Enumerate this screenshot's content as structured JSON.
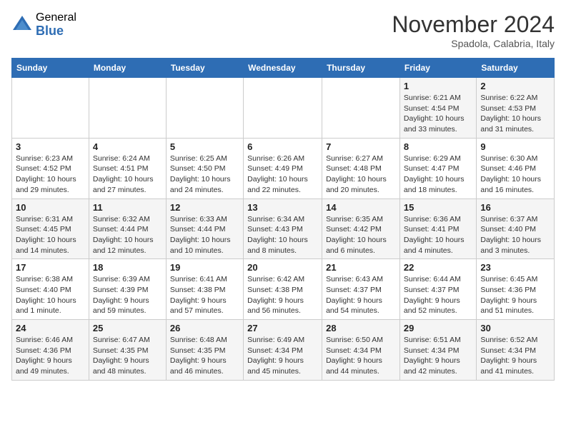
{
  "logo": {
    "general": "General",
    "blue": "Blue"
  },
  "title": "November 2024",
  "location": "Spadola, Calabria, Italy",
  "headers": [
    "Sunday",
    "Monday",
    "Tuesday",
    "Wednesday",
    "Thursday",
    "Friday",
    "Saturday"
  ],
  "weeks": [
    [
      {
        "day": "",
        "info": ""
      },
      {
        "day": "",
        "info": ""
      },
      {
        "day": "",
        "info": ""
      },
      {
        "day": "",
        "info": ""
      },
      {
        "day": "",
        "info": ""
      },
      {
        "day": "1",
        "info": "Sunrise: 6:21 AM\nSunset: 4:54 PM\nDaylight: 10 hours and 33 minutes."
      },
      {
        "day": "2",
        "info": "Sunrise: 6:22 AM\nSunset: 4:53 PM\nDaylight: 10 hours and 31 minutes."
      }
    ],
    [
      {
        "day": "3",
        "info": "Sunrise: 6:23 AM\nSunset: 4:52 PM\nDaylight: 10 hours and 29 minutes."
      },
      {
        "day": "4",
        "info": "Sunrise: 6:24 AM\nSunset: 4:51 PM\nDaylight: 10 hours and 27 minutes."
      },
      {
        "day": "5",
        "info": "Sunrise: 6:25 AM\nSunset: 4:50 PM\nDaylight: 10 hours and 24 minutes."
      },
      {
        "day": "6",
        "info": "Sunrise: 6:26 AM\nSunset: 4:49 PM\nDaylight: 10 hours and 22 minutes."
      },
      {
        "day": "7",
        "info": "Sunrise: 6:27 AM\nSunset: 4:48 PM\nDaylight: 10 hours and 20 minutes."
      },
      {
        "day": "8",
        "info": "Sunrise: 6:29 AM\nSunset: 4:47 PM\nDaylight: 10 hours and 18 minutes."
      },
      {
        "day": "9",
        "info": "Sunrise: 6:30 AM\nSunset: 4:46 PM\nDaylight: 10 hours and 16 minutes."
      }
    ],
    [
      {
        "day": "10",
        "info": "Sunrise: 6:31 AM\nSunset: 4:45 PM\nDaylight: 10 hours and 14 minutes."
      },
      {
        "day": "11",
        "info": "Sunrise: 6:32 AM\nSunset: 4:44 PM\nDaylight: 10 hours and 12 minutes."
      },
      {
        "day": "12",
        "info": "Sunrise: 6:33 AM\nSunset: 4:44 PM\nDaylight: 10 hours and 10 minutes."
      },
      {
        "day": "13",
        "info": "Sunrise: 6:34 AM\nSunset: 4:43 PM\nDaylight: 10 hours and 8 minutes."
      },
      {
        "day": "14",
        "info": "Sunrise: 6:35 AM\nSunset: 4:42 PM\nDaylight: 10 hours and 6 minutes."
      },
      {
        "day": "15",
        "info": "Sunrise: 6:36 AM\nSunset: 4:41 PM\nDaylight: 10 hours and 4 minutes."
      },
      {
        "day": "16",
        "info": "Sunrise: 6:37 AM\nSunset: 4:40 PM\nDaylight: 10 hours and 3 minutes."
      }
    ],
    [
      {
        "day": "17",
        "info": "Sunrise: 6:38 AM\nSunset: 4:40 PM\nDaylight: 10 hours and 1 minute."
      },
      {
        "day": "18",
        "info": "Sunrise: 6:39 AM\nSunset: 4:39 PM\nDaylight: 9 hours and 59 minutes."
      },
      {
        "day": "19",
        "info": "Sunrise: 6:41 AM\nSunset: 4:38 PM\nDaylight: 9 hours and 57 minutes."
      },
      {
        "day": "20",
        "info": "Sunrise: 6:42 AM\nSunset: 4:38 PM\nDaylight: 9 hours and 56 minutes."
      },
      {
        "day": "21",
        "info": "Sunrise: 6:43 AM\nSunset: 4:37 PM\nDaylight: 9 hours and 54 minutes."
      },
      {
        "day": "22",
        "info": "Sunrise: 6:44 AM\nSunset: 4:37 PM\nDaylight: 9 hours and 52 minutes."
      },
      {
        "day": "23",
        "info": "Sunrise: 6:45 AM\nSunset: 4:36 PM\nDaylight: 9 hours and 51 minutes."
      }
    ],
    [
      {
        "day": "24",
        "info": "Sunrise: 6:46 AM\nSunset: 4:36 PM\nDaylight: 9 hours and 49 minutes."
      },
      {
        "day": "25",
        "info": "Sunrise: 6:47 AM\nSunset: 4:35 PM\nDaylight: 9 hours and 48 minutes."
      },
      {
        "day": "26",
        "info": "Sunrise: 6:48 AM\nSunset: 4:35 PM\nDaylight: 9 hours and 46 minutes."
      },
      {
        "day": "27",
        "info": "Sunrise: 6:49 AM\nSunset: 4:34 PM\nDaylight: 9 hours and 45 minutes."
      },
      {
        "day": "28",
        "info": "Sunrise: 6:50 AM\nSunset: 4:34 PM\nDaylight: 9 hours and 44 minutes."
      },
      {
        "day": "29",
        "info": "Sunrise: 6:51 AM\nSunset: 4:34 PM\nDaylight: 9 hours and 42 minutes."
      },
      {
        "day": "30",
        "info": "Sunrise: 6:52 AM\nSunset: 4:34 PM\nDaylight: 9 hours and 41 minutes."
      }
    ]
  ]
}
